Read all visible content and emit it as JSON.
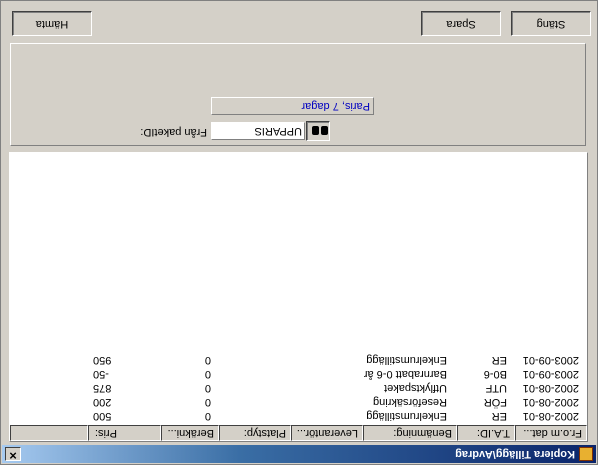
{
  "window": {
    "title": "Kopiera Tillägg\\Avdrag"
  },
  "list": {
    "columns": [
      "Fr.o.m dat...",
      "T.A.ID:",
      "Benämning:",
      "Leverantör...",
      "Platstyp:",
      "Beräkni...",
      "Pris:"
    ],
    "rows": [
      [
        "2002-08-01",
        "ER",
        "Enkelrumstillägg",
        "",
        "",
        "0",
        "500"
      ],
      [
        "2002-08-01",
        "FÖR",
        "Reseförsäkring",
        "",
        "",
        "0",
        "200"
      ],
      [
        "2002-08-01",
        "UTF",
        "Utflyktspaket",
        "",
        "",
        "0",
        "875"
      ],
      [
        "2003-09-01",
        "B0-6",
        "Barnrabatt 0-6 år",
        "",
        "",
        "0",
        "-50"
      ],
      [
        "2003-09-01",
        "ER",
        "Enkelrumstillägg",
        "",
        "",
        "0",
        "950"
      ]
    ]
  },
  "form": {
    "package_label": "Från paketID:",
    "package_value": "UPPARIS",
    "package_name": "Paris, 7 dagar"
  },
  "buttons": {
    "fetch": "Hämta",
    "save": "Spara",
    "close": "Stäng"
  },
  "icons": {
    "app": "app-icon",
    "close": "close-icon",
    "search": "binoculars-icon"
  }
}
